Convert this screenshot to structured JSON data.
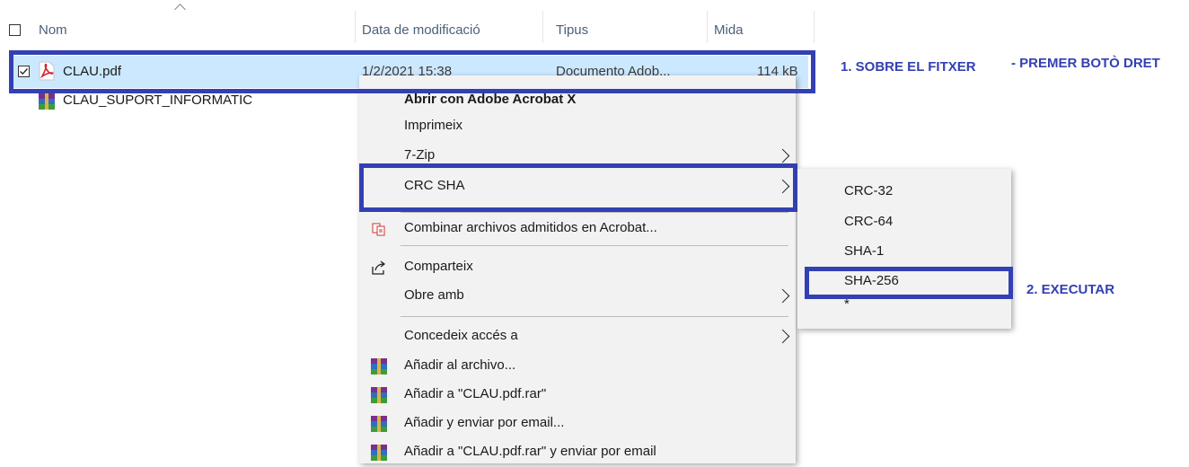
{
  "header": {
    "col_name": "Nom",
    "col_date": "Data de modificació",
    "col_type": "Tipus",
    "col_size": "Mida"
  },
  "files": [
    {
      "name": "CLAU.pdf",
      "date": "1/2/2021 15:38",
      "type": "Documento Adob...",
      "size": "114 kB",
      "icon": "pdf-icon",
      "selected": true
    },
    {
      "name": "CLAU_SUPORT_INFORMATIC",
      "date": "",
      "type": "",
      "size": "",
      "icon": "winrar-archive-icon",
      "selected": false
    }
  ],
  "context_menu": {
    "items": [
      {
        "label": "Abrir con Adobe Acrobat X",
        "bold": true
      },
      {
        "label": "Imprimeix"
      },
      {
        "label": "7-Zip",
        "submenu": true
      },
      {
        "label": "CRC SHA",
        "submenu": true
      },
      {
        "label": "Combinar archivos admitidos en Acrobat...",
        "icon": "acrobat-combine-icon"
      },
      {
        "label": "Comparteix",
        "icon": "share-icon"
      },
      {
        "label": "Obre amb",
        "submenu": true
      },
      {
        "label": "Concedeix accés a",
        "submenu": true
      },
      {
        "label": "Añadir al archivo...",
        "icon": "winrar-icon"
      },
      {
        "label": "Añadir a \"CLAU.pdf.rar\"",
        "icon": "winrar-icon"
      },
      {
        "label": "Añadir y enviar por email...",
        "icon": "winrar-icon"
      },
      {
        "label": "Añadir a \"CLAU.pdf.rar\" y enviar por email",
        "icon": "winrar-icon"
      }
    ]
  },
  "submenu": {
    "items": [
      "CRC-32",
      "CRC-64",
      "SHA-1",
      "SHA-256",
      "*"
    ]
  },
  "annotations": {
    "step1": "1. SOBRE EL FITXER",
    "step1b": "- PREMER BOTÒ DRET",
    "step2": "2. EXECUTAR"
  },
  "colors": {
    "highlight": "#3340b3",
    "selection": "#cce8ff",
    "menu_bg": "#f2f2f2"
  }
}
